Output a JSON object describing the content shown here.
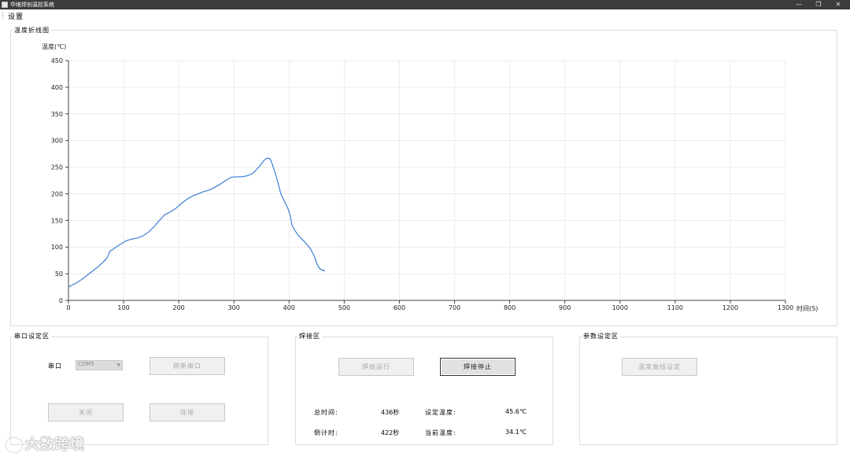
{
  "window": {
    "title": "华维焊创温控系统",
    "controls": {
      "minimize": "—",
      "restore": "❐",
      "close": "✕"
    }
  },
  "menu": {
    "settings": "设置"
  },
  "chart_panel": {
    "group_label": "温度折线图"
  },
  "chart_data": {
    "type": "line",
    "title": "",
    "xlabel": "时间(S)",
    "ylabel": "温度(℃)",
    "xlim": [
      0,
      1300
    ],
    "ylim": [
      0,
      450
    ],
    "xticks": [
      0,
      100,
      200,
      300,
      400,
      500,
      600,
      700,
      800,
      900,
      1000,
      1100,
      1200,
      1300
    ],
    "yticks": [
      0,
      50,
      100,
      150,
      200,
      250,
      300,
      350,
      400,
      450
    ],
    "grid": true,
    "line_color": "#3a7fd5",
    "series": [
      {
        "x": [
          0,
          5,
          15,
          25,
          35,
          45,
          55,
          65,
          70,
          75,
          85,
          95,
          105,
          115,
          125,
          135,
          145,
          155,
          165,
          175,
          185,
          195,
          205,
          215,
          225,
          235,
          245,
          255,
          265,
          275,
          285,
          295,
          305,
          315,
          325,
          335,
          345,
          355,
          360,
          365,
          368,
          372,
          378,
          385,
          392,
          398,
          402,
          405,
          410,
          418,
          428,
          438,
          445,
          450,
          455,
          460,
          465
        ],
        "y": [
          25,
          28,
          33,
          40,
          48,
          56,
          64,
          74,
          80,
          92,
          99,
          106,
          112,
          115,
          117,
          121,
          128,
          138,
          150,
          161,
          166,
          173,
          182,
          190,
          196,
          200,
          204,
          207,
          212,
          218,
          225,
          231,
          232,
          232,
          234,
          239,
          250,
          263,
          267,
          266,
          260,
          248,
          228,
          200,
          185,
          172,
          160,
          142,
          132,
          120,
          110,
          98,
          85,
          70,
          60,
          57,
          55
        ]
      }
    ]
  },
  "serial_panel": {
    "group_label": "串口设定区",
    "port_label": "串口",
    "port_value": "COM5",
    "refresh_button": "刷新串口",
    "close_button": "关闭",
    "connect_button": "连接"
  },
  "weld_panel": {
    "group_label": "焊接区",
    "run_button": "焊接运行",
    "stop_button": "焊接停止",
    "total_time_label": "总时间:",
    "total_time_value": "436秒",
    "set_temp_label": "设定温度:",
    "set_temp_value": "45.6℃",
    "countdown_label": "倒计时:",
    "countdown_value": "422秒",
    "current_temp_label": "当前温度:",
    "current_temp_value": "34.1℃"
  },
  "param_panel": {
    "group_label": "参数设定区",
    "curve_button": "温度曲线设定"
  },
  "watermark": {
    "text": "大数跨境"
  }
}
